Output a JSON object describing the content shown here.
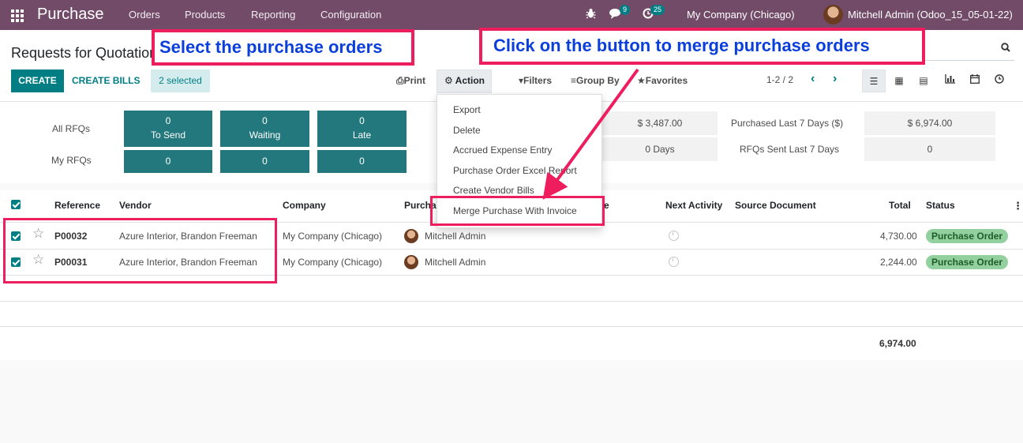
{
  "navbar": {
    "app_name": "Purchase",
    "menu": [
      "Orders",
      "Products",
      "Reporting",
      "Configuration"
    ],
    "messages_count": "9",
    "activities_count": "25",
    "company": "My Company (Chicago)",
    "user": "Mitchell Admin (Odoo_15_05-01-22)"
  },
  "control_panel": {
    "title": "Requests for Quotation",
    "create_label": "CREATE",
    "create_bills_label": "CREATE BILLS",
    "selected_label": "2 selected",
    "print_label": "Print",
    "action_label": "Action",
    "filters_label": "Filters",
    "groupby_label": "Group By",
    "favorites_label": "Favorites",
    "pager": "1-2 / 2"
  },
  "dashboard": {
    "row_labels": [
      "All RFQs",
      "My RFQs"
    ],
    "tiles": [
      {
        "count": "0",
        "label": "To Send",
        "my_count": "0"
      },
      {
        "count": "0",
        "label": "Waiting",
        "my_count": "0"
      },
      {
        "count": "0",
        "label": "Late",
        "my_count": "0"
      }
    ],
    "avg_order_value": "$ 3,487.00",
    "purchased_last_7_label": "Purchased Last 7 Days ($)",
    "purchased_last_7_value": "$ 6,974.00",
    "lead_time": "0  Days",
    "rfqs_sent_label": "RFQs Sent Last 7 Days",
    "rfqs_sent_value": "0"
  },
  "action_menu": {
    "items": [
      "Export",
      "Delete",
      "Accrued Expense Entry",
      "Purchase Order Excel Report",
      "Create Vendor Bills",
      "Merge Purchase With Invoice"
    ]
  },
  "table": {
    "columns": {
      "reference": "Reference",
      "vendor": "Vendor",
      "company": "Company",
      "purchase_rep": "Purcha",
      "deadline": "e",
      "next_activity": "Next Activity",
      "source": "Source Document",
      "total": "Total",
      "status": "Status"
    },
    "rows": [
      {
        "reference": "P00032",
        "vendor": "Azure Interior, Brandon Freeman",
        "company": "My Company (Chicago)",
        "rep": "Mitchell Admin",
        "total": "4,730.00",
        "status": "Purchase Order"
      },
      {
        "reference": "P00031",
        "vendor": "Azure Interior, Brandon Freeman",
        "company": "My Company (Chicago)",
        "rep": "Mitchell Admin",
        "total": "2,244.00",
        "status": "Purchase Order"
      }
    ],
    "grand_total": "6,974.00"
  },
  "annotations": {
    "select_text": "Select the purchase orders",
    "click_text": "Click on the button to merge purchase orders"
  },
  "colors": {
    "navbar": "#714b67",
    "primary": "#017e84",
    "tile": "#23787d",
    "annotation_border": "#ee1d5e",
    "annotation_text": "#0b3fdc",
    "status_badge": "#93d09f"
  }
}
